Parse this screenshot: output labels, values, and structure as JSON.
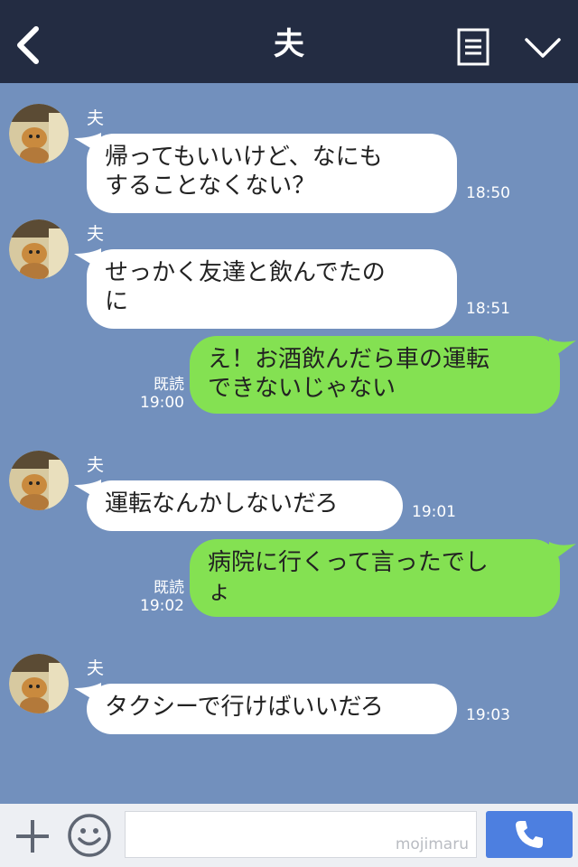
{
  "header": {
    "title": "夫"
  },
  "messages": [
    {
      "from": "in",
      "name": "夫",
      "text": "帰ってもいいけど、なにも\nすることなくない？",
      "time": "18:50"
    },
    {
      "from": "in",
      "name": "夫",
      "text": "せっかく友達と飲んでたの\nに",
      "time": "18:51"
    },
    {
      "from": "out",
      "read": "既読",
      "text": "え！お酒飲んだら車の運転\nできないじゃない",
      "time": "19:00"
    },
    {
      "from": "in",
      "name": "夫",
      "text": "運転なんかしないだろ",
      "time": "19:01"
    },
    {
      "from": "out",
      "read": "既読",
      "text": "病院に行くって言ったでし\nょ",
      "time": "19:02"
    },
    {
      "from": "in",
      "name": "夫",
      "text": "タクシーで行けばいいだろ",
      "time": "19:03"
    }
  ],
  "footer": {
    "watermark": "mojimaru"
  },
  "colors": {
    "header": "#232c42",
    "background": "#7290bd",
    "incoming": "#ffffff",
    "outgoing": "#84e152",
    "call": "#4d7fe0"
  }
}
